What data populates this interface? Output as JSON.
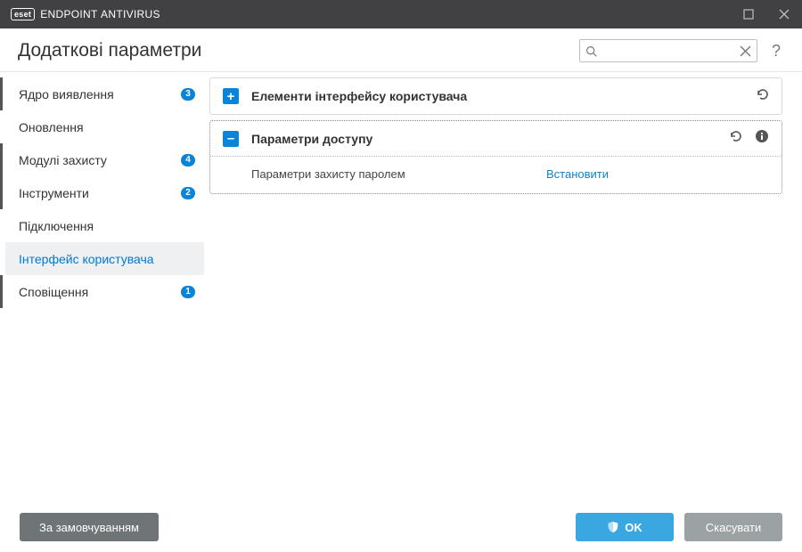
{
  "titlebar": {
    "brand": "eset",
    "product_prefix": "ENDPOINT",
    "product_suffix": "ANTIVIRUS"
  },
  "header": {
    "title": "Додаткові параметри",
    "search_placeholder": " ",
    "help_glyph": "?"
  },
  "sidebar": {
    "items": [
      {
        "label": "Ядро виявлення",
        "badge": "3",
        "marked": true,
        "active": false
      },
      {
        "label": "Оновлення",
        "badge": null,
        "marked": false,
        "active": false
      },
      {
        "label": "Модулі захисту",
        "badge": "4",
        "marked": true,
        "active": false
      },
      {
        "label": "Інструменти",
        "badge": "2",
        "marked": true,
        "active": false
      },
      {
        "label": "Підключення",
        "badge": null,
        "marked": false,
        "active": false
      },
      {
        "label": "Інтерфейс користувача",
        "badge": null,
        "marked": false,
        "active": true
      },
      {
        "label": "Сповіщення",
        "badge": "1",
        "marked": true,
        "active": false
      }
    ]
  },
  "panels": [
    {
      "title": "Елементи інтерфейсу користувача",
      "expanded": false,
      "show_undo": true,
      "show_info": false
    },
    {
      "title": "Параметри доступу",
      "expanded": true,
      "show_undo": true,
      "show_info": true,
      "settings": [
        {
          "label": "Параметри захисту паролем",
          "action": "Встановити"
        }
      ]
    }
  ],
  "footer": {
    "default_btn": "За замовчуванням",
    "ok_btn": "OK",
    "cancel_btn": "Скасувати"
  }
}
